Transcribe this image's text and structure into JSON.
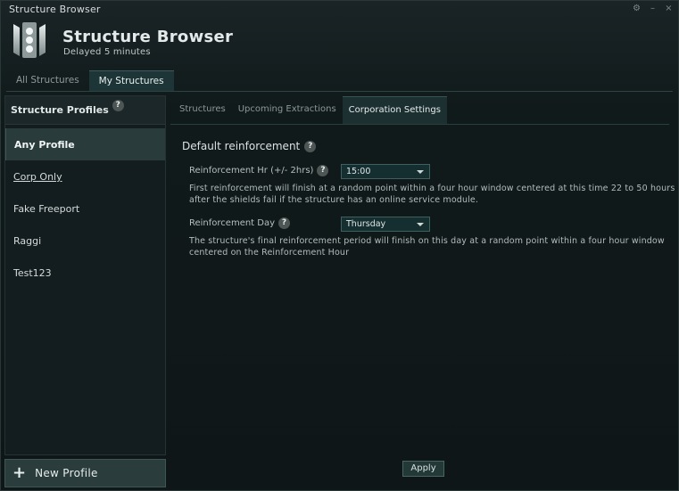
{
  "window": {
    "title": "Structure Browser",
    "controls": [
      "⚙",
      "–",
      "×"
    ]
  },
  "header": {
    "title": "Structure Browser",
    "subtitle": "Delayed 5 minutes"
  },
  "top_tabs": [
    {
      "label": "All Structures",
      "active": false
    },
    {
      "label": "My Structures",
      "active": true
    }
  ],
  "profiles": {
    "header": "Structure Profiles",
    "help": "?",
    "items": [
      {
        "label": "Any Profile",
        "active": true
      },
      {
        "label": "Corp Only",
        "active": false
      },
      {
        "label": "Fake Freeport",
        "active": false
      },
      {
        "label": "Raggi",
        "active": false
      },
      {
        "label": "Test123",
        "active": false
      }
    ],
    "new_profile": {
      "icon": "+",
      "label": "New Profile"
    }
  },
  "sub_tabs": [
    {
      "label": "Structures",
      "active": false
    },
    {
      "label": "Upcoming Extractions",
      "active": false
    },
    {
      "label": "Corporation Settings",
      "active": true
    }
  ],
  "settings": {
    "section_title": "Default reinforcement",
    "help": "?",
    "reinforcement_hour": {
      "label": "Reinforcement Hr (+/- 2hrs)",
      "value": "15:00",
      "description": "First reinforcement will finish at a random point within a four hour window centered at this time 22 to 50 hours after the shields fail if the structure has an online service module."
    },
    "reinforcement_day": {
      "label": "Reinforcement Day",
      "value": "Thursday",
      "description": "The structure's final reinforcement period will finish on this day at a random point within a four hour window centered on the Reinforcement Hour"
    },
    "apply_label": "Apply"
  },
  "colors": {
    "accent": "#1e3537",
    "background": "#111a1b",
    "text": "#c8cfcf"
  }
}
